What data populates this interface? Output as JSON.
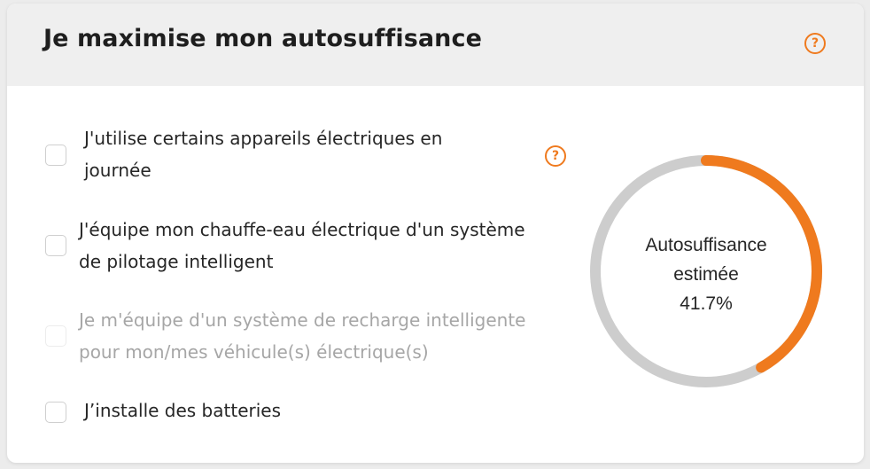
{
  "header": {
    "title": "Je maximise mon autosuffisance",
    "help_icon": "question-circle-icon"
  },
  "options": [
    {
      "label_lines": [
        "J'utilise certains appareils électriques en",
        "journée"
      ],
      "checked": false,
      "disabled": false,
      "has_help": true
    },
    {
      "label_lines": [
        "J'équipe mon chauffe-eau électrique d'un système",
        "de pilotage intelligent"
      ],
      "checked": false,
      "disabled": false,
      "has_help": false
    },
    {
      "label_lines": [
        "Je m'équipe d'un système de recharge intelligente",
        "pour mon/mes véhicule(s) électrique(s)"
      ],
      "checked": false,
      "disabled": true,
      "has_help": false
    },
    {
      "label_lines": [
        "J’installe des batteries"
      ],
      "checked": false,
      "disabled": false,
      "has_help": false
    }
  ],
  "gauge": {
    "label_line1": "Autosuffisance",
    "label_line2": "estimée",
    "value_text": "41.7%",
    "value_fraction": 0.417
  },
  "colors": {
    "accent": "#ef7a1e",
    "track": "#cdcdcd",
    "header_bg": "#efefef"
  }
}
